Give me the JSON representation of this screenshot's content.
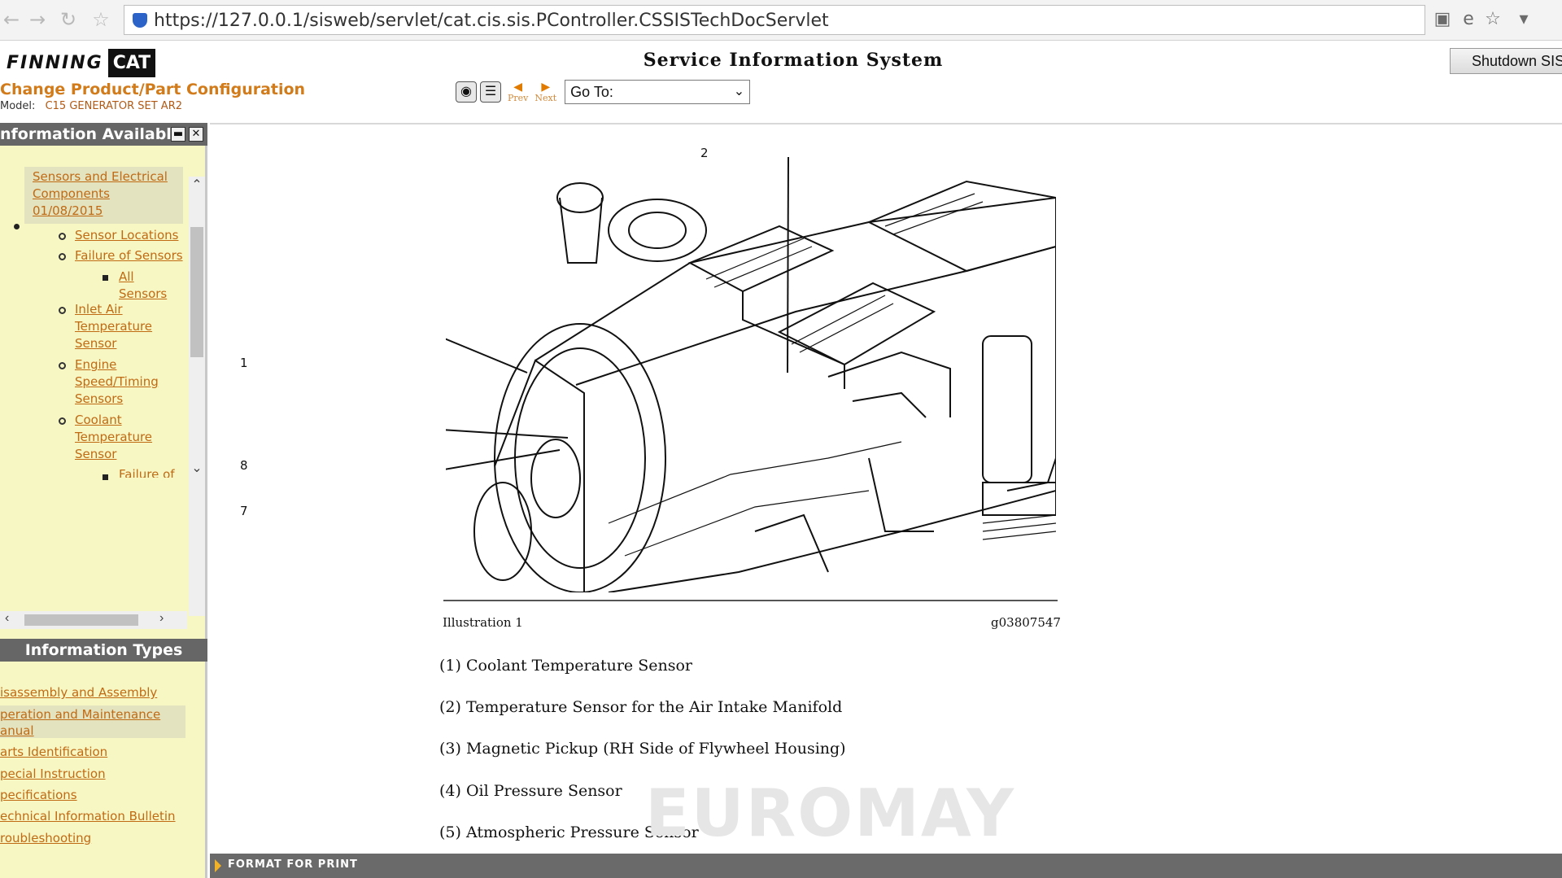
{
  "browser": {
    "url": "https://127.0.0.1/sisweb/servlet/cat.cis.sis.PController.CSSISTechDocServlet",
    "icons": [
      "back-arrow-icon",
      "forward-arrow-icon",
      "reload-icon",
      "favorite-star-icon",
      "site-shield-icon",
      "compatibility-view-icon",
      "ie-icon",
      "bookmark-star-icon",
      "dropdown-arrow-icon"
    ]
  },
  "header": {
    "logo_text": "FINNING",
    "logo_brand": "CAT",
    "title": "Service Information System",
    "shutdown_label": "Shutdown SIS",
    "change_product": "Change Product/Part Configuration",
    "model_label": "Model:",
    "model_value": "C15 GENERATOR SET AR2",
    "toolbar": {
      "prev": "Prev",
      "next": "Next",
      "goto": "Go To:"
    }
  },
  "sidebar": {
    "info_title": "nformation Available",
    "tree": {
      "top_link": "Sensors and Electrical Components",
      "date_link": "01/08/2015",
      "items": [
        "Sensor Locations",
        "Failure of Sensors",
        "All Sensors",
        "Inlet Air Temperature Sensor",
        "Engine Speed/Timing Sensors",
        "Coolant Temperature Sensor",
        "Failure of"
      ]
    },
    "types_title": "Information Types",
    "types": [
      "isassembly and Assembly",
      "peration and Maintenance anual",
      "arts Identification",
      "pecial Instruction",
      "pecifications",
      "echnical Information Bulletin",
      "roubleshooting"
    ]
  },
  "main": {
    "callouts": [
      "2",
      "1",
      "8",
      "7"
    ],
    "illustration_caption": "Illustration 1",
    "illustration_code": "g03807547",
    "legend": [
      "(1) Coolant Temperature Sensor",
      "(2) Temperature Sensor for the Air Intake Manifold",
      "(3) Magnetic Pickup (RH Side of Flywheel Housing)",
      "(4) Oil Pressure Sensor",
      "(5) Atmospheric Pressure Sensor"
    ],
    "watermark": "EUROMAY",
    "format_for_print": "FORMAT FOR PRINT"
  }
}
